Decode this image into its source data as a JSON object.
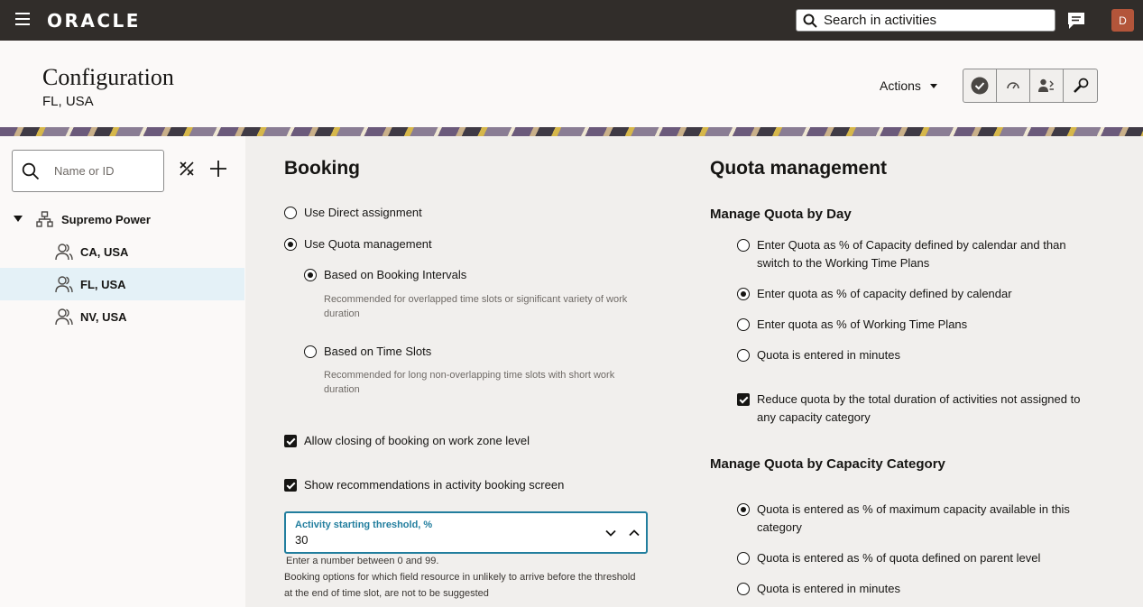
{
  "app": {
    "logo": "ORACLE",
    "search_placeholder": "Search in activities",
    "avatar_initial": "D"
  },
  "header": {
    "title": "Configuration",
    "subtitle": "FL, USA",
    "actions_label": "Actions",
    "toolbar": [
      "check-circle-icon",
      "gauge-icon",
      "users-settings-icon",
      "wrench-icon"
    ]
  },
  "tree": {
    "search_placeholder": "Name or ID",
    "root": "Supremo Power",
    "children": [
      "CA, USA",
      "FL, USA",
      "NV, USA"
    ],
    "selected": "FL, USA"
  },
  "booking": {
    "title": "Booking",
    "direct_assignment": "Use Direct assignment",
    "quota_management": "Use Quota management",
    "booking_intervals": "Based on Booking Intervals",
    "booking_intervals_hint_1": "Recommended for overlapped time slots or significant variety of work",
    "booking_intervals_hint_2": "duration",
    "time_slots": "Based on Time Slots",
    "time_slots_hint_1": "Recommended for long non-overlapping time slots with short work",
    "time_slots_hint_2": "duration",
    "allow_closing": "Allow closing of booking on work zone level",
    "show_recommendations": "Show recommendations in activity booking screen",
    "threshold_label": "Activity starting threshold, %",
    "threshold_value": "30",
    "threshold_help_1": "Enter a number between 0 and 99.",
    "threshold_help_2": "Booking options for which field resource in unlikely to arrive before the threshold",
    "threshold_help_3": "at the end of time slot, are not to be suggested"
  },
  "quota": {
    "title": "Quota management",
    "by_day_title": "Manage Quota by Day",
    "by_day_opt1_line1": "Enter Quota as % of Capacity defined by calendar and than",
    "by_day_opt1_line2": "switch to the Working Time Plans",
    "by_day_opt2": "Enter quota as % of capacity defined by calendar",
    "by_day_opt3": "Enter quota as % of Working Time Plans",
    "by_day_opt4": "Quota is entered in minutes",
    "reduce_line1": "Reduce quota by the total duration of activities not assigned to",
    "reduce_line2": "any capacity category",
    "by_cat_title": "Manage Quota by Capacity Category",
    "by_cat_opt1_line1": "Quota is entered as % of maximum capacity available in this",
    "by_cat_opt1_line2": "category",
    "by_cat_opt2": "Quota is entered as % of quota defined on parent level",
    "by_cat_opt3": "Quota is entered in minutes"
  },
  "colors": {
    "topbar": "#312d2a",
    "accent": "#227e9e",
    "selected_row": "#e4f1f7",
    "avatar": "#b3553a"
  }
}
